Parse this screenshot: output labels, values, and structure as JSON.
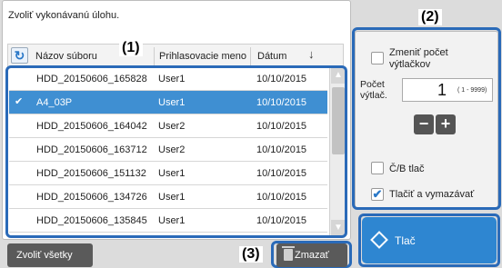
{
  "instruction": "Zvoliť vykonávanú úlohu.",
  "columns": {
    "name": "Názov súboru",
    "user": "Prihlasovacie meno",
    "date": "Dátum"
  },
  "annotations": {
    "one": "(1)",
    "two": "(2)",
    "three": "(3)"
  },
  "rows": [
    {
      "name": "HDD_20150606_165828",
      "user": "User1",
      "date": "10/10/2015",
      "selected": false
    },
    {
      "name": "A4_03P",
      "user": "User1",
      "date": "10/10/2015",
      "selected": true
    },
    {
      "name": "HDD_20150606_164042",
      "user": "User2",
      "date": "10/10/2015",
      "selected": false
    },
    {
      "name": "HDD_20150606_163712",
      "user": "User2",
      "date": "10/10/2015",
      "selected": false
    },
    {
      "name": "HDD_20150606_151132",
      "user": "User1",
      "date": "10/10/2015",
      "selected": false
    },
    {
      "name": "HDD_20150606_134726",
      "user": "User1",
      "date": "10/10/2015",
      "selected": false
    },
    {
      "name": "HDD_20150606_135845",
      "user": "User1",
      "date": "10/10/2015",
      "selected": false
    }
  ],
  "options": {
    "change_copies": "Zmeniť počet výtlačkov",
    "copies_label": "Počet výtlač.",
    "copies_value": "1",
    "copies_range": "( 1 - 9999)",
    "bw_print": "Č/B tlač",
    "print_delete": "Tlačiť a vymazávať",
    "print_delete_checked": true,
    "change_copies_checked": false,
    "bw_print_checked": false
  },
  "buttons": {
    "select_all": "Zvoliť všetky",
    "delete": "Zmazať",
    "print": "Tlač"
  },
  "colors": {
    "accent": "#2e86d1",
    "selected_row": "#3f8fd2",
    "annotation": "#2a6ab8"
  }
}
